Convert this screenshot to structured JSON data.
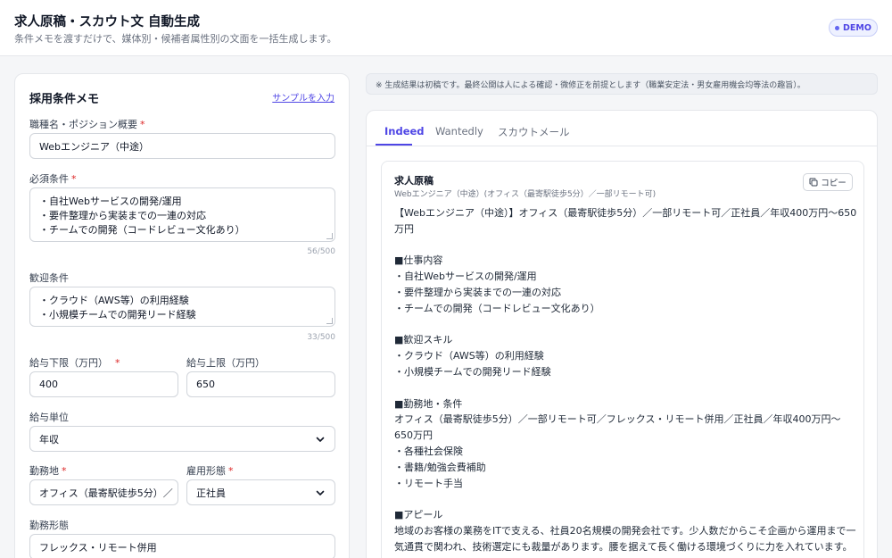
{
  "header": {
    "title": "求人原稿・スカウト文 自動生成",
    "subtitle": "条件メモを渡すだけで、媒体別・候補者属性別の文面を一括生成します。",
    "badge": "DEMO"
  },
  "form": {
    "title": "採用条件メモ",
    "sample_link": "サンプルを入力",
    "position": {
      "label": "職種名・ポジション概要",
      "value": "Webエンジニア（中途）"
    },
    "required": {
      "label": "必須条件",
      "lines": [
        "・自社Webサービスの開発/運用",
        "・要件整理から実装までの一連の対応",
        "・チームでの開発（コードレビュー文化あり）"
      ],
      "counter": "56/500"
    },
    "preferred": {
      "label": "歓迎条件",
      "lines": [
        "・クラウド（AWS等）の利用経験",
        "・小規模チームでの開発リード経験"
      ],
      "counter": "33/500"
    },
    "salary_min": {
      "label": "給与下限（万円）",
      "value": "400"
    },
    "salary_max": {
      "label": "給与上限（万円）",
      "value": "650"
    },
    "salary_unit": {
      "label": "給与単位",
      "value": "年収"
    },
    "location": {
      "label": "勤務地",
      "value": "オフィス（最寄駅徒歩5分）／"
    },
    "employment": {
      "label": "雇用形態",
      "value": "正社員"
    },
    "work_style": {
      "label": "勤務形態",
      "value": "フレックス・リモート併用"
    },
    "required_mark": "*"
  },
  "notice": "※ 生成結果は初稿です。最終公開は人による確認・微修正を前提とします（職業安定法・男女雇用機会均等法の趣旨）。",
  "tabs": [
    "Indeed",
    "Wantedly",
    "スカウトメール"
  ],
  "result": {
    "title": "求人原稿",
    "subtitle": "Webエンジニア（中途）(オフィス（最寄駅徒歩5分）／一部リモート可)",
    "copy_label": "コピー",
    "lines": [
      "【Webエンジニア（中途）】オフィス（最寄駅徒歩5分）／一部リモート可／正社員／年収400万円〜650",
      "万円",
      "",
      "■仕事内容",
      "・自社Webサービスの開発/運用",
      "・要件整理から実装までの一連の対応",
      "・チームでの開発（コードレビュー文化あり）",
      "",
      "■歓迎スキル",
      "・クラウド（AWS等）の利用経験",
      "・小規模チームでの開発リード経験",
      "",
      "■勤務地・条件",
      "オフィス（最寄駅徒歩5分）／一部リモート可／フレックス・リモート併用／正社員／年収400万円〜",
      "650万円",
      "・各種社会保険",
      "・書籍/勉強会費補助",
      "・リモート手当",
      "",
      "■アピール",
      "地域のお客様の業務をITで支える、社員20名規模の開発会社です。少人数だからこそ企画から運用まで一",
      "気通貫で関われ、技術選定にも裁量があります。腰を据えて長く働ける環境づくりに力を入れています。"
    ]
  },
  "colors": {
    "accent": "#4f46e5",
    "required": "#dc2626"
  }
}
